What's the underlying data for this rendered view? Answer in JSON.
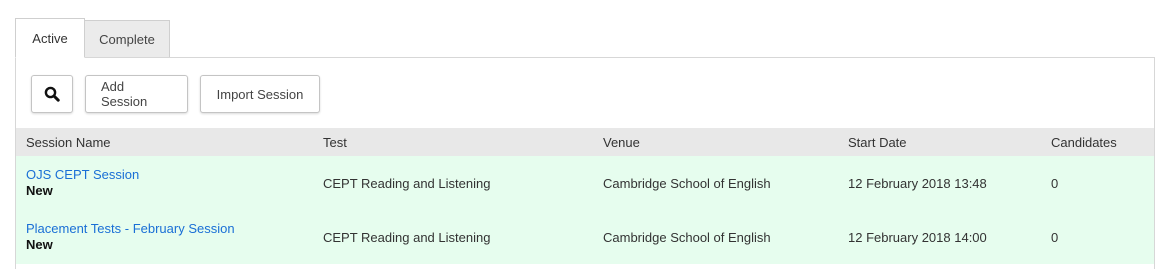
{
  "tabs": [
    {
      "label": "Active"
    },
    {
      "label": "Complete"
    }
  ],
  "toolbar": {
    "search_icon": "search-icon",
    "add_label": "Add Session",
    "import_label": "Import Session"
  },
  "table": {
    "headers": {
      "name": "Session Name",
      "test": "Test",
      "venue": "Venue",
      "start_date": "Start Date",
      "candidates": "Candidates"
    },
    "rows": [
      {
        "name": "OJS CEPT Session",
        "status": "New",
        "test": "CEPT Reading and Listening",
        "venue": "Cambridge School of English",
        "start_date": "12 February 2018 13:48",
        "candidates": "0"
      },
      {
        "name": "Placement Tests - February Session",
        "status": "New",
        "test": "CEPT Reading and Listening",
        "venue": "Cambridge School of English",
        "start_date": "12 February 2018 14:00",
        "candidates": "0"
      }
    ]
  },
  "colors": {
    "link": "#1a6fd6",
    "row_background": "#e6fdee",
    "header_background": "#e8e8e8"
  }
}
